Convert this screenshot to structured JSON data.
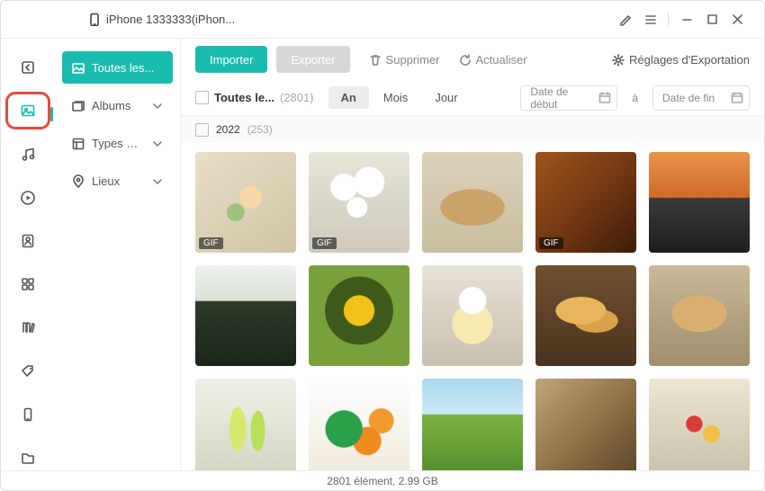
{
  "header": {
    "device": "iPhone 1333333(iPhon..."
  },
  "iconbar": [
    {
      "name": "export-icon"
    },
    {
      "name": "photos-icon"
    },
    {
      "name": "music-icon"
    },
    {
      "name": "video-icon"
    },
    {
      "name": "contacts-icon"
    },
    {
      "name": "apps-icon"
    },
    {
      "name": "books-icon"
    },
    {
      "name": "tags-icon"
    },
    {
      "name": "device-icon"
    },
    {
      "name": "files-icon"
    }
  ],
  "sidebar": {
    "items": [
      {
        "label": "Toutes les..."
      },
      {
        "label": "Albums"
      },
      {
        "label": "Types de..."
      },
      {
        "label": "Lieux"
      }
    ]
  },
  "toolbar": {
    "importer": "Importer",
    "exporter": "Exporter",
    "supprimer": "Supprimer",
    "actualiser": "Actualiser",
    "reglages": "Réglages d'Exportation"
  },
  "filter": {
    "all_label": "Toutes le...",
    "all_count": "(2801)",
    "seg": {
      "an": "An",
      "mois": "Mois",
      "jour": "Jour"
    },
    "date_start": "Date de début",
    "to": "à",
    "date_end": "Date de fin"
  },
  "year": {
    "label": "2022",
    "count": "(253)"
  },
  "photos": [
    {
      "cls": "p1",
      "badge": "GIF"
    },
    {
      "cls": "p2",
      "badge": "GIF"
    },
    {
      "cls": "p3"
    },
    {
      "cls": "p4",
      "badge": "GIF"
    },
    {
      "cls": "p5"
    },
    {
      "cls": "p6"
    },
    {
      "cls": "p7"
    },
    {
      "cls": "p8"
    },
    {
      "cls": "p9"
    },
    {
      "cls": "p10"
    },
    {
      "cls": "p11"
    },
    {
      "cls": "p12"
    },
    {
      "cls": "p13"
    },
    {
      "cls": "p14"
    },
    {
      "cls": "p15"
    }
  ],
  "status": "2801 élément, 2.99 GB"
}
